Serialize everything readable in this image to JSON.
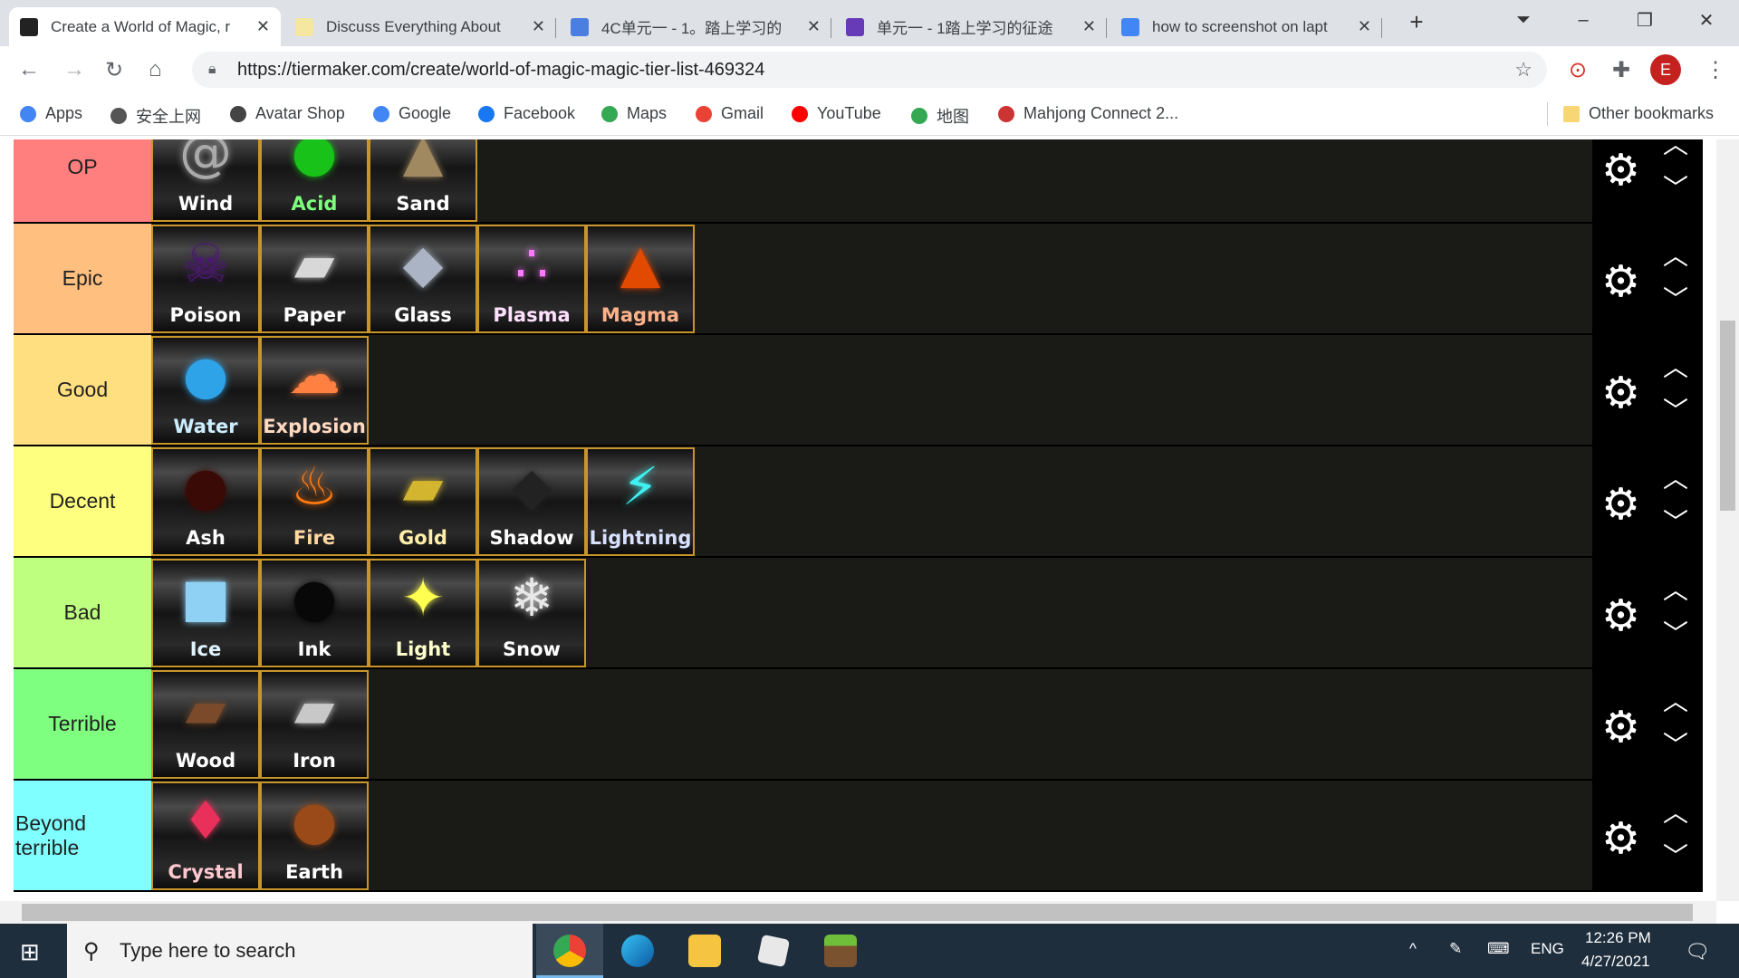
{
  "browser": {
    "tabs": [
      {
        "title": "Create a World of Magic, r",
        "active": true,
        "icon": "tiermaker-icon",
        "color": "#222"
      },
      {
        "title": "Discuss Everything About",
        "active": false,
        "icon": "sparkle-icon",
        "color": "#f5e6a0"
      },
      {
        "title": "4C单元一 - 1。踏上学习的",
        "active": false,
        "icon": "classroom-icon",
        "color": "#4a7ee0"
      },
      {
        "title": "单元一 - 1踏上学习的征途",
        "active": false,
        "icon": "forms-icon",
        "color": "#673ab7"
      },
      {
        "title": "how to screenshot on lapt",
        "active": false,
        "icon": "google-icon",
        "color": "#4285f4"
      }
    ],
    "url": "https://tiermaker.com/create/world-of-magic-magic-tier-list-469324",
    "profile_initial": "E",
    "bookmarks": [
      {
        "label": "Apps",
        "color": "#4285f4"
      },
      {
        "label": "安全上网",
        "color": "#555"
      },
      {
        "label": "Avatar Shop",
        "color": "#444"
      },
      {
        "label": "Google",
        "color": "#4285f4"
      },
      {
        "label": "Facebook",
        "color": "#1877f2"
      },
      {
        "label": "Maps",
        "color": "#34a853"
      },
      {
        "label": "Gmail",
        "color": "#ea4335"
      },
      {
        "label": "YouTube",
        "color": "#ff0000"
      },
      {
        "label": "地图",
        "color": "#34a853"
      },
      {
        "label": "Mahjong Connect 2...",
        "color": "#c33"
      }
    ],
    "other_bookmarks": "Other bookmarks"
  },
  "tiers": [
    {
      "label": "OP",
      "color": "#ff7f7f",
      "items": [
        {
          "name": "Wind",
          "glyph": "@",
          "icon_color": "#aaa",
          "text_color": "#ffffff"
        },
        {
          "name": "Acid",
          "glyph": "●",
          "icon_color": "#19c219",
          "text_color": "#7dff7d"
        },
        {
          "name": "Sand",
          "glyph": "▲",
          "icon_color": "#a08860",
          "text_color": "#ffffff"
        }
      ]
    },
    {
      "label": "Epic",
      "color": "#ffbf7f",
      "items": [
        {
          "name": "Poison",
          "glyph": "☠",
          "icon_color": "#4a1a6e",
          "text_color": "#ffffff"
        },
        {
          "name": "Paper",
          "glyph": "▰",
          "icon_color": "#d8d8d8",
          "text_color": "#ffffff"
        },
        {
          "name": "Glass",
          "glyph": "◆",
          "icon_color": "#aab4c4",
          "text_color": "#ffffff"
        },
        {
          "name": "Plasma",
          "glyph": "∴",
          "icon_color": "#ff7aff",
          "text_color": "#ffe0ff"
        },
        {
          "name": "Magma",
          "glyph": "▲",
          "icon_color": "#e14a00",
          "text_color": "#ffb28a"
        }
      ]
    },
    {
      "label": "Good",
      "color": "#ffdf7f",
      "items": [
        {
          "name": "Water",
          "glyph": "●",
          "icon_color": "#2ea3e8",
          "text_color": "#cdeeff"
        },
        {
          "name": "Explosion",
          "glyph": "☁",
          "icon_color": "#ff8040",
          "text_color": "#ffd9c0"
        }
      ]
    },
    {
      "label": "Decent",
      "color": "#ffff7f",
      "items": [
        {
          "name": "Ash",
          "glyph": "●",
          "icon_color": "#3a0a06",
          "text_color": "#ffffff"
        },
        {
          "name": "Fire",
          "glyph": "♨",
          "icon_color": "#ff7a10",
          "text_color": "#ffd9a0"
        },
        {
          "name": "Gold",
          "glyph": "▰",
          "icon_color": "#d4b530",
          "text_color": "#ffeeaa"
        },
        {
          "name": "Shadow",
          "glyph": "◆",
          "icon_color": "#222",
          "text_color": "#ffffff"
        },
        {
          "name": "Lightning",
          "glyph": "⚡",
          "icon_color": "#40f0f0",
          "text_color": "#d8e0ff"
        }
      ]
    },
    {
      "label": "Bad",
      "color": "#bfff7f",
      "items": [
        {
          "name": "Ice",
          "glyph": "■",
          "icon_color": "#8fd0f5",
          "text_color": "#e0f4ff"
        },
        {
          "name": "Ink",
          "glyph": "●",
          "icon_color": "#080808",
          "text_color": "#ffffff"
        },
        {
          "name": "Light",
          "glyph": "✦",
          "icon_color": "#ffff50",
          "text_color": "#ffffcc"
        },
        {
          "name": "Snow",
          "glyph": "❄",
          "icon_color": "#e8e8e8",
          "text_color": "#ffffff"
        }
      ]
    },
    {
      "label": "Terrible",
      "color": "#7fff7f",
      "items": [
        {
          "name": "Wood",
          "glyph": "▰",
          "icon_color": "#7a4a2a",
          "text_color": "#ffffff"
        },
        {
          "name": "Iron",
          "glyph": "▰",
          "icon_color": "#c8c8c8",
          "text_color": "#ffffff"
        }
      ]
    },
    {
      "label": "Beyond terrible",
      "color": "#7fffff",
      "items": [
        {
          "name": "Crystal",
          "glyph": "♦",
          "icon_color": "#e8305a",
          "text_color": "#ffc8d0"
        },
        {
          "name": "Earth",
          "glyph": "●",
          "icon_color": "#9a4a18",
          "text_color": "#ffffff"
        }
      ]
    }
  ],
  "taskbar": {
    "search_placeholder": "Type here to search",
    "language": "ENG",
    "time": "12:26 PM",
    "date": "4/27/2021"
  }
}
